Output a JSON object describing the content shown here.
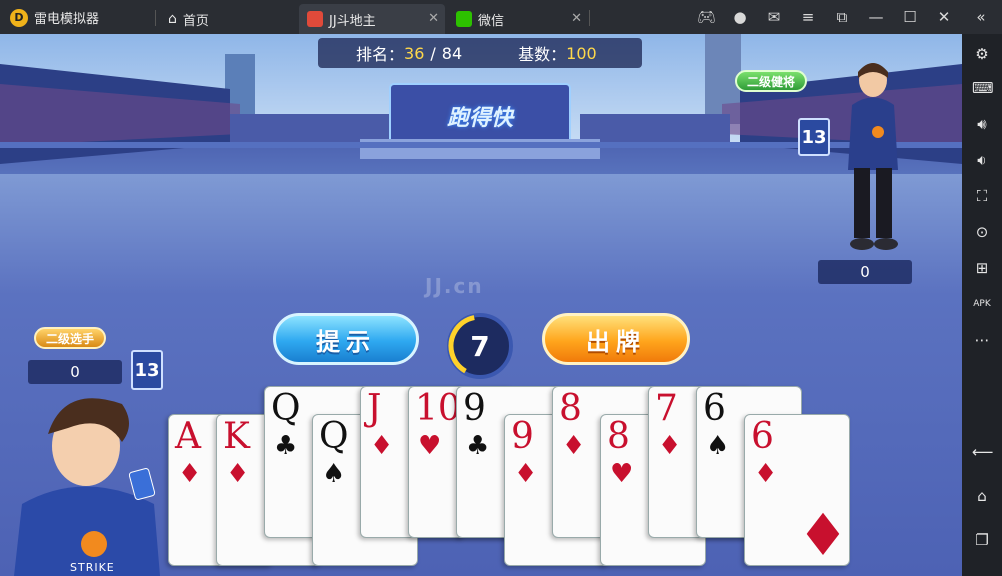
{
  "window": {
    "app_name": "雷电模拟器",
    "tabs": [
      {
        "label": "首页"
      },
      {
        "label": "JJ斗地主"
      },
      {
        "label": "微信"
      }
    ],
    "close_glyph": "✕"
  },
  "game": {
    "rank_label": "排名：",
    "rank_value": "36",
    "rank_sep": "/",
    "rank_total": "84",
    "base_label": "基数：",
    "base_value": "100",
    "stage_sign": "跑得快",
    "watermark": "JJ.cn",
    "right_player": {
      "title": "二级健将",
      "card_count": "13",
      "score": "0"
    },
    "left_player": {
      "title": "二级选手",
      "card_count": "13",
      "score": "0"
    },
    "hint_button": "提示",
    "play_button": "出牌",
    "timer": "7",
    "shirt_text": "STRIKE"
  },
  "hand": [
    {
      "rank": "A",
      "suit": "♦",
      "color": "red"
    },
    {
      "rank": "K",
      "suit": "♦",
      "color": "red"
    },
    {
      "rank": "Q",
      "suit": "♣",
      "color": "blk"
    },
    {
      "rank": "Q",
      "suit": "♠",
      "color": "blk"
    },
    {
      "rank": "J",
      "suit": "♦",
      "color": "red"
    },
    {
      "rank": "10",
      "suit": "♥",
      "color": "red"
    },
    {
      "rank": "9",
      "suit": "♣",
      "color": "blk"
    },
    {
      "rank": "9",
      "suit": "♦",
      "color": "red"
    },
    {
      "rank": "8",
      "suit": "♦",
      "color": "red"
    },
    {
      "rank": "8",
      "suit": "♥",
      "color": "red"
    },
    {
      "rank": "7",
      "suit": "♦",
      "color": "red"
    },
    {
      "rank": "6",
      "suit": "♠",
      "color": "blk"
    },
    {
      "rank": "6",
      "suit": "♦",
      "color": "red"
    }
  ],
  "icons": {
    "accent": "#f0b21a",
    "hint_blue": "#2ea8f0",
    "play_orange": "#ffa51c"
  }
}
